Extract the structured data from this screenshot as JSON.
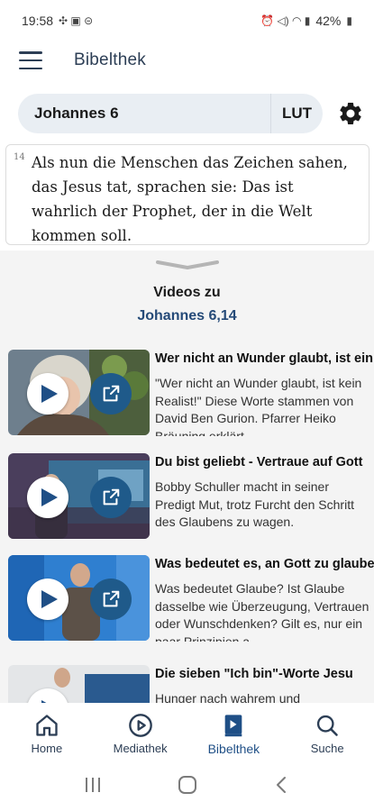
{
  "status": {
    "time": "19:58",
    "battery": "42%"
  },
  "appbar": {
    "title": "Bibelthek"
  },
  "search": {
    "passage": "Johannes 6",
    "translation": "LUT"
  },
  "verse": {
    "number": "14",
    "text": "Als nun die Menschen das Zeichen sahen, das Jesus tat, sprachen sie: Das ist wahrlich der Prophet, der in die Welt kommen soll."
  },
  "videos_section": {
    "title": "Videos zu",
    "reference": "Johannes 6,14"
  },
  "videos": [
    {
      "title": "Wer nicht an Wunder glaubt, ist ein Realist",
      "description": "\"Wer nicht an Wunder glaubt, ist kein Realist!\" Diese Worte stammen von David Ben Gurion. Pfarrer Heiko Bräuning  erklärt, ..."
    },
    {
      "title": "Du bist geliebt - Vertraue auf Gott",
      "description": "Bobby Schuller macht in seiner Predigt Mut, trotz Furcht den Schritt des Glaubens zu wagen."
    },
    {
      "title": "Was bedeutet es, an Gott zu glauben?",
      "description": "Was bedeutet Glaube? Ist Glaube dasselbe wie Überzeugung, Vertrauen oder Wunschdenken? Gilt es, nur ein paar Prinzipien a..."
    },
    {
      "title": "Die sieben \"Ich bin\"-Worte Jesu",
      "description": "Hunger nach wahrem und"
    }
  ],
  "nav": [
    {
      "label": "Home",
      "icon": "home-icon"
    },
    {
      "label": "Mediathek",
      "icon": "play-circle-icon"
    },
    {
      "label": "Bibelthek",
      "icon": "bible-icon",
      "active": true
    },
    {
      "label": "Suche",
      "icon": "search-icon"
    }
  ],
  "colors": {
    "accent": "#1f5a8a",
    "active_nav": "#1f4f86",
    "pill_bg": "#e9eef3",
    "sheet_bg": "#f4f4f4"
  }
}
